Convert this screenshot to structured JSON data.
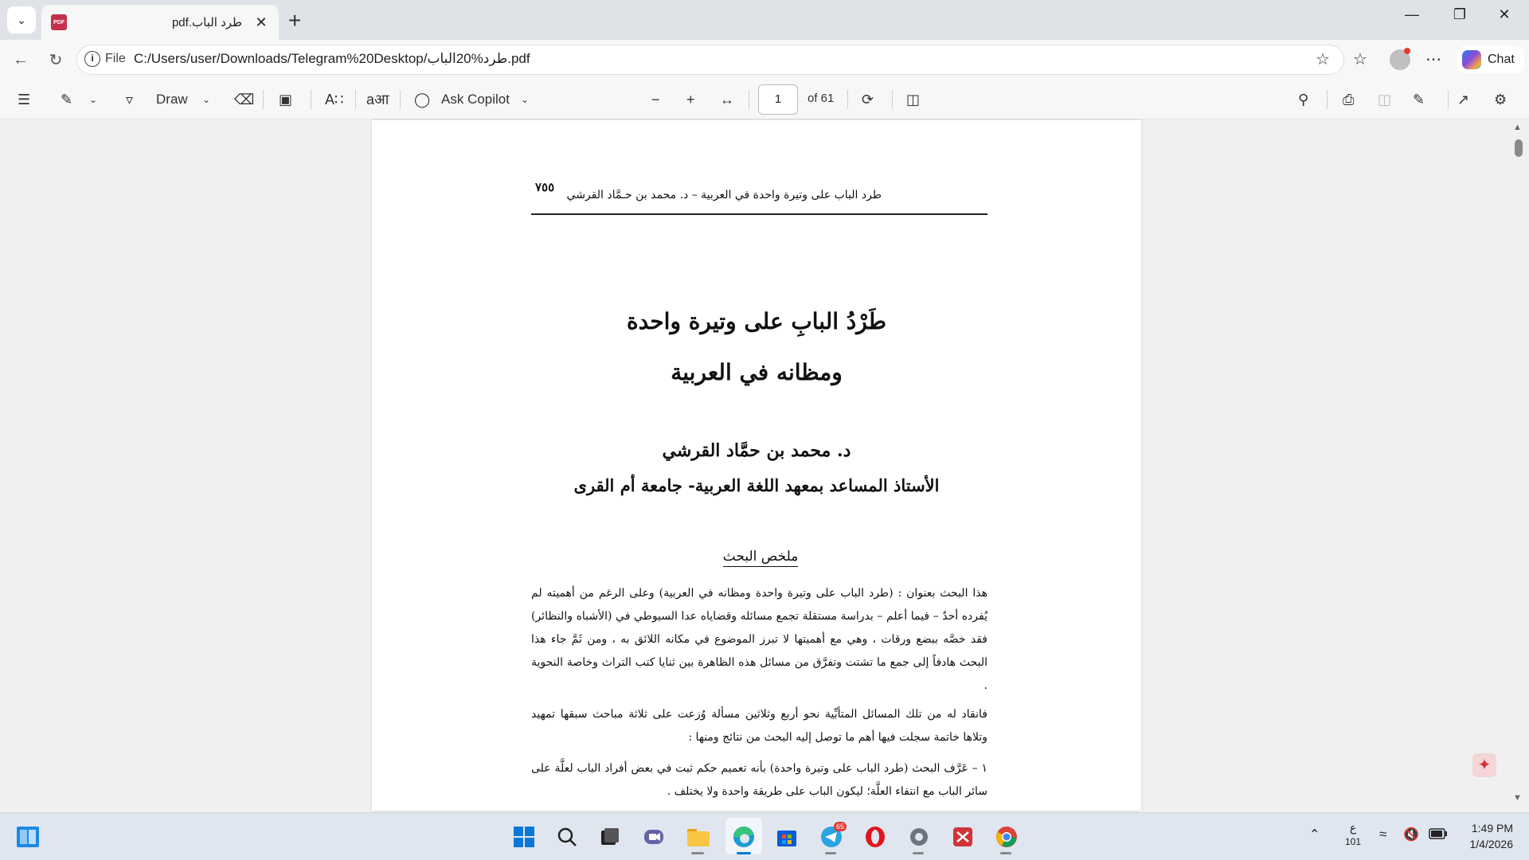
{
  "browser": {
    "tab_title": "طرد الباب.pdf",
    "omnibox": {
      "scheme_label": "File",
      "url": "C:/Users/user/Downloads/Telegram%20Desktop/طرد%20الباب.pdf"
    },
    "chat_label": "Chat"
  },
  "pdf_toolbar": {
    "draw_label": "Draw",
    "ask_copilot_label": "Ask Copilot",
    "page_number": "1",
    "page_total": "of 61"
  },
  "document": {
    "header_page_number": "٧٥٥",
    "header_text": "طرد الباب على وتيرة واحدة في العربية – د. محمد بن حـمَّاد القرشي",
    "title_line1": "طَرْدُ البابِ على وتيرة واحدة",
    "title_line2": "ومظانه في العربية",
    "author": "د. محمد بن حمَّاد القرشي",
    "affiliation": "الأستاذ المساعد بمعهد اللغة العربية- جامعة أم القرى",
    "abstract_heading": "ملخص البحث",
    "paragraph1": "هذا البحث بعنوان : (طرد الباب على وتيرة واحدة ومظانه في العربية) وعلى الرغم من أهميته لم يُفرده أحدٌ – فيما أعلم – بدراسة مستقلة تجمع مسائله وقضاياه عدا السيوطي في (الأشباه والنظائر) فقد خصَّه ببضع ورقات ، وهي مع أهميتها لا تبرز الموضوع في مكانه اللائق به ، ومن ثَمَّ جاء هذا البحث هادفاً إلى جمع ما تشتت وتفرَّق من مسائل هذه الظاهرة بين ثنايا كتب التراث وخاصة النحوية .",
    "paragraph2": "فانقاد له من تلك المسائل المتأبِّية نحو أربع وثلاثين مسألة وُزعت على ثلاثة مباحث سبقها تمهيد وتلاها خاتمة سجلت فيها أهم ما توصل إليه البحث من نتائج ومنها :",
    "paragraph3": "١ – عَرَّف البحث (طرد الباب على وتيرة واحدة) بأنه تعميم حكم ثبت في بعض أفراد الباب لعلَّة على سائر الباب مع انتفاء العلَّة؛ ليكون الباب على طريقة واحدة ولا يختلف ."
  },
  "taskbar": {
    "telegram_badge": "65",
    "language_indicator": "ع",
    "language_sub": "101",
    "time": "1:49 PM",
    "date": "1/4/2026"
  },
  "icons": {
    "pdf_tab": "pdf-file-icon",
    "acrobat": "acrobat-icon"
  },
  "colors": {
    "accent": "#0078d4",
    "pdf_red": "#c4314b"
  }
}
